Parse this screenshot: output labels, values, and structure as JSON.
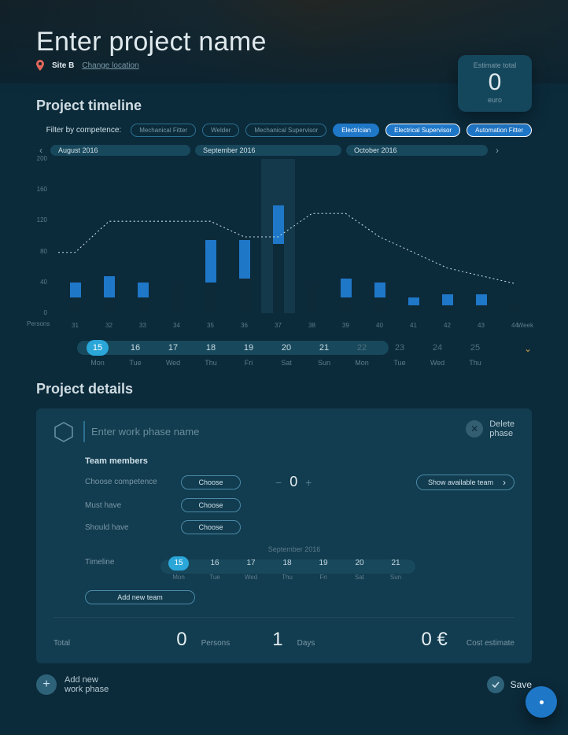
{
  "hero": {
    "title": "Enter project name",
    "location_name": "Site B",
    "change_location": "Change location"
  },
  "estimate": {
    "label": "Estimate total",
    "value": "0",
    "currency": "euro"
  },
  "timeline": {
    "heading": "Project timeline",
    "filter_label": "Filter by competence:",
    "chips": [
      {
        "label": "Mechanical Fitter",
        "active": false
      },
      {
        "label": "Welder",
        "active": false
      },
      {
        "label": "Mechanical Supervisor",
        "active": false
      },
      {
        "label": "Electrician",
        "active": true
      },
      {
        "label": "Electrical Supervisor",
        "active": true
      },
      {
        "label": "Automation Fitter",
        "active": true
      }
    ],
    "months": [
      "August 2016",
      "September 2016",
      "October 2016"
    ],
    "y_axis_label": "Persons",
    "x_axis_end": "Week"
  },
  "chart_data": {
    "type": "bar",
    "ylabel": "Persons",
    "xlabel": "Week",
    "ylim": [
      0,
      200
    ],
    "yticks": [
      0,
      40,
      80,
      120,
      160,
      200
    ],
    "categories": [
      "31",
      "32",
      "33",
      "34",
      "35",
      "36",
      "37",
      "38",
      "39",
      "40",
      "41",
      "42",
      "43",
      "44"
    ],
    "highlight_category": "37",
    "series": [
      {
        "name": "Electrician",
        "color": "#1f77c8",
        "values": [
          20,
          28,
          20,
          0,
          55,
          50,
          50,
          0,
          25,
          20,
          10,
          15,
          15,
          0
        ]
      },
      {
        "name": "Electrical Supervisor",
        "color": "#0d2a38",
        "values": [
          20,
          20,
          20,
          40,
          40,
          45,
          90,
          40,
          20,
          20,
          10,
          10,
          10,
          12
        ]
      }
    ],
    "trend": {
      "name": "Total",
      "values": [
        80,
        120,
        120,
        120,
        120,
        100,
        100,
        130,
        130,
        100,
        80,
        60,
        50,
        40
      ]
    }
  },
  "days_main": {
    "items": [
      {
        "num": "15",
        "name": "Mon",
        "selected": true,
        "dim": false
      },
      {
        "num": "16",
        "name": "Tue",
        "selected": false,
        "dim": false
      },
      {
        "num": "17",
        "name": "Wed",
        "selected": false,
        "dim": false
      },
      {
        "num": "18",
        "name": "Thu",
        "selected": false,
        "dim": false
      },
      {
        "num": "19",
        "name": "Fri",
        "selected": false,
        "dim": false
      },
      {
        "num": "20",
        "name": "Sat",
        "selected": false,
        "dim": false
      },
      {
        "num": "21",
        "name": "Sun",
        "selected": false,
        "dim": false
      },
      {
        "num": "22",
        "name": "Mon",
        "selected": false,
        "dim": true
      },
      {
        "num": "23",
        "name": "Tue",
        "selected": false,
        "dim": true
      },
      {
        "num": "24",
        "name": "Wed",
        "selected": false,
        "dim": true
      },
      {
        "num": "25",
        "name": "Thu",
        "selected": false,
        "dim": true
      }
    ]
  },
  "details": {
    "heading": "Project details",
    "phase_placeholder": "Enter work phase name",
    "delete_line1": "Delete",
    "delete_line2": "phase",
    "team_heading": "Team members",
    "rows": {
      "competence": {
        "label": "Choose competence",
        "button": "Choose"
      },
      "must_have": {
        "label": "Must have",
        "button": "Choose"
      },
      "should_have": {
        "label": "Should have",
        "button": "Choose"
      }
    },
    "stepper_value": "0",
    "show_team": "Show available team",
    "timeline_label": "Timeline",
    "mini_month": "September 2016",
    "mini_days": [
      {
        "num": "15",
        "name": "Mon",
        "selected": true
      },
      {
        "num": "16",
        "name": "Tue",
        "selected": false
      },
      {
        "num": "17",
        "name": "Wed",
        "selected": false
      },
      {
        "num": "18",
        "name": "Thu",
        "selected": false
      },
      {
        "num": "19",
        "name": "Fri",
        "selected": false
      },
      {
        "num": "20",
        "name": "Sat",
        "selected": false
      },
      {
        "num": "21",
        "name": "Sun",
        "selected": false
      }
    ],
    "add_team": "Add new team",
    "footer": {
      "total_label": "Total",
      "persons_value": "0",
      "persons_unit": "Persons",
      "days_value": "1",
      "days_unit": "Days",
      "cost_value": "0 €",
      "cost_label": "Cost estimate"
    }
  },
  "bottom": {
    "add_line1": "Add new",
    "add_line2": "work phase",
    "save": "Save"
  }
}
